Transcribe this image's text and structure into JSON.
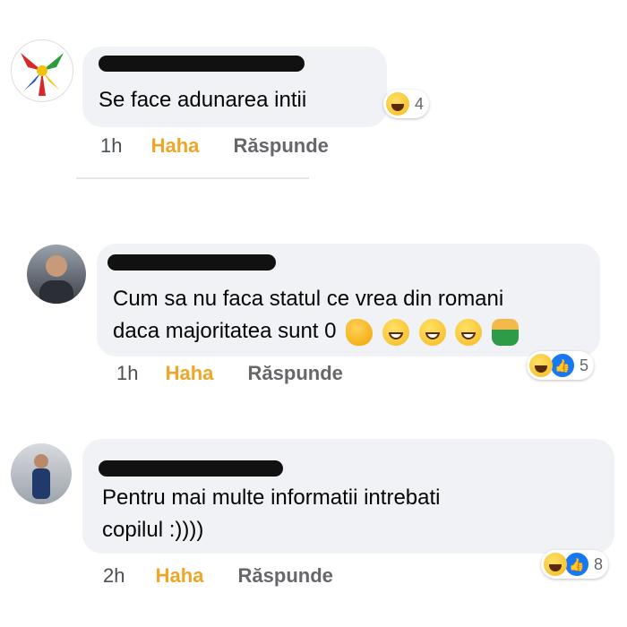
{
  "comments": [
    {
      "avatar_desc": "ribbon-avatar",
      "text_lines": [
        "Se face adunarea intii"
      ],
      "time": "1h",
      "haha_label": "Haha",
      "reply_label": "Răspunde",
      "reaction_count": "4"
    },
    {
      "avatar_desc": "person-avatar",
      "text_lines": [
        "Cum sa nu faca statul ce vrea din romani",
        "daca majoritatea sunt 0"
      ],
      "time": "1h",
      "haha_label": "Haha",
      "reply_label": "Răspunde",
      "reaction_count": "5"
    },
    {
      "avatar_desc": "person-avatar",
      "text_lines": [
        "Pentru mai multe informatii intrebati",
        "copilul :))))"
      ],
      "time": "2h",
      "haha_label": "Haha",
      "reply_label": "Răspunde",
      "reaction_count": "8"
    }
  ],
  "colors": {
    "bubble": "#f0f2f5",
    "haha": "#f0a525",
    "like": "#1877f2",
    "meta": "#65676b"
  }
}
